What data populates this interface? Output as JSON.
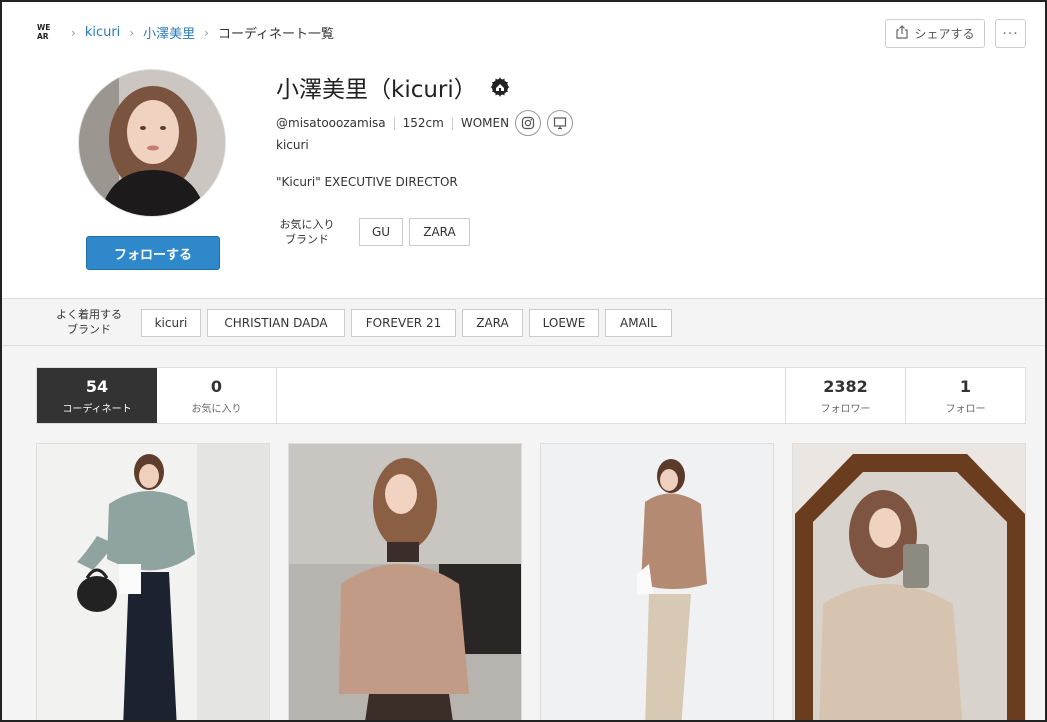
{
  "logo_text": "WEAR",
  "breadcrumb": [
    "kicuri",
    "小澤美里",
    "コーディネート一覧"
  ],
  "share_label": "シェアする",
  "more_label": "···",
  "profile": {
    "name": "小澤美里（kicuri）",
    "username": "@misatooozamisa",
    "height": "152cm",
    "gender": "WOMEN",
    "handle": "kicuri",
    "bio": "\"Kicuri\" EXECUTIVE DIRECTOR",
    "follow_label": "フォローする",
    "fav_brands_label": "お気に入り\nブランド",
    "fav_brands": [
      "GU",
      "ZARA"
    ]
  },
  "often_worn": {
    "label": "よく着用する\nブランド",
    "brands": [
      "kicuri",
      "CHRISTIAN DADA",
      "FOREVER 21",
      "ZARA",
      "LOEWE",
      "AMAIL"
    ]
  },
  "stats": [
    {
      "num": "54",
      "label": "コーディネート"
    },
    {
      "num": "0",
      "label": "お気に入り"
    },
    {
      "num": "2382",
      "label": "フォロワー"
    },
    {
      "num": "1",
      "label": "フォロー"
    }
  ],
  "icons": [
    "share-icon",
    "instagram-icon",
    "website-icon",
    "wear-badge-icon"
  ],
  "colors": {
    "follow_button": "#2f88c9",
    "link": "#2a7ab8",
    "active_tab": "#333333"
  }
}
